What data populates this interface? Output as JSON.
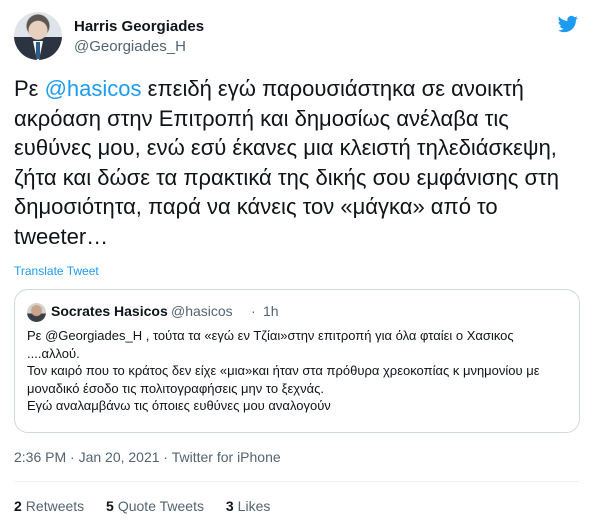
{
  "author": {
    "name": "Harris Georgiades",
    "handle": "@Georgiades_H"
  },
  "tweet": {
    "prefix": "Ρε ",
    "mention": "@hasicos",
    "body": " επειδή εγώ παρουσιάστηκα σε ανοικτή ακρόαση στην Επιτροπή και δημοσίως ανέλαβα τις ευθύνες μου, ενώ εσύ έκανες μια κλειστή τηλεδιάσκεψη, ζήτα και δώσε τα πρακτικά της δικής σου εμφάνισης στη δημοσιότητα, παρά να κάνεις τον «μάγκα» από το tweeter…",
    "translate_label": "Translate Tweet"
  },
  "quote": {
    "name": "Socrates Hasicos",
    "handle": "@hasicos",
    "separator": "·",
    "time": "1h",
    "text": "Ρε @Georgiades_H , τούτα τα «εγώ εν Τζίαι»στην επιτροπή για όλα φταίει ο Χασικος ....αλλού.\nΤον καιρό που το κράτος δεν είχε «μια»και ήταν στα πρόθυρα χρεοκοπίας κ μνημονίου με μοναδικό έσοδο τις πολιτογραφήσεις μην το ξεχνάς.\n Εγώ αναλαμβάνω τις όποιες ευθύνες μου αναλογούν"
  },
  "meta": {
    "timestamp": "2:36 PM · Jan 20, 2021 · Twitter for iPhone"
  },
  "stats": {
    "retweets_count": "2",
    "retweets_label": "Retweets",
    "quotes_count": "5",
    "quotes_label": "Quote Tweets",
    "likes_count": "3",
    "likes_label": "Likes"
  },
  "colors": {
    "accent": "#1d9bf0",
    "secondary_text": "#536471",
    "border": "#cfd9de"
  },
  "icons": {
    "logo": "twitter-bird-icon"
  }
}
